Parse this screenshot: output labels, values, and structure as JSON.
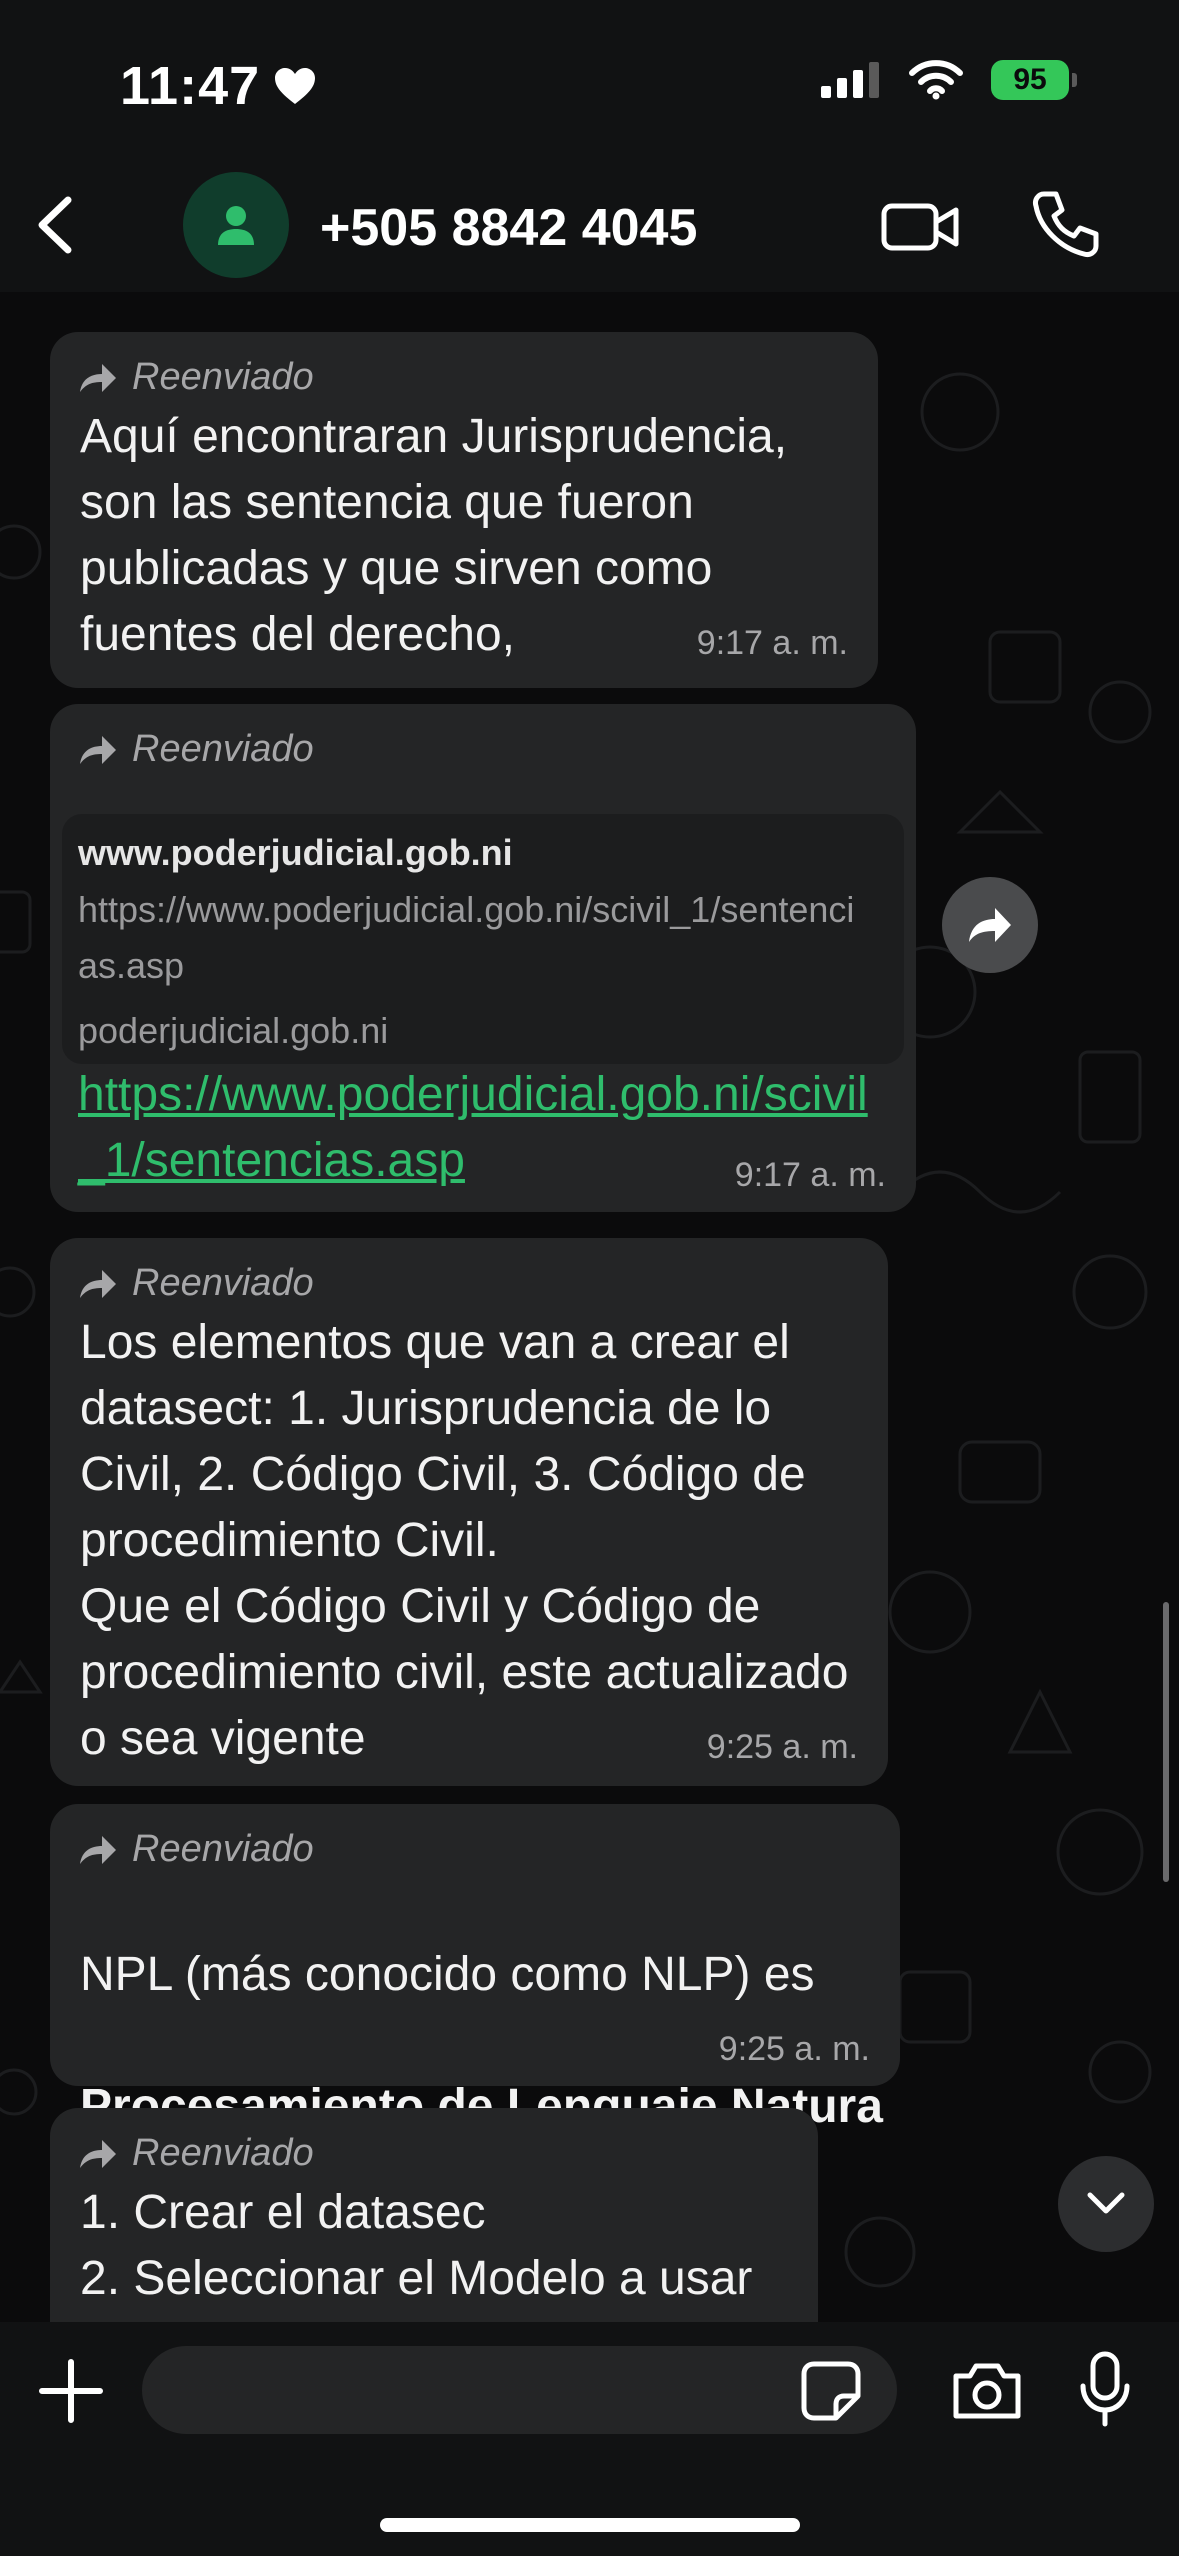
{
  "status": {
    "time": "11:47",
    "battery": "95"
  },
  "header": {
    "contact": "+505 8842 4045"
  },
  "messages": [
    {
      "forwarded": "Reenviado",
      "text": "Aquí encontraran Jurisprudencia, son las sentencia que fueron publicadas y que sirven como fuentes del derecho,",
      "time": "9:17 a. m."
    },
    {
      "forwarded": "Reenviado",
      "preview_title": "www.poderjudicial.gob.ni",
      "preview_url": "https://www.poderjudicial.gob.ni/scivil_1/sentencias.asp",
      "preview_domain": "poderjudicial.gob.ni",
      "link": "https://www.poderjudicial.gob.ni/scivil_1/sentencias.asp",
      "time": "9:17 a. m."
    },
    {
      "forwarded": "Reenviado",
      "text": "Los elementos que van a crear el datasect: 1. Jurisprudencia de lo Civil, 2. Código Civil, 3. Código de procedimiento Civil.\nQue el Código Civil y Código de procedimiento civil, este actualizado o sea vigente",
      "time": "9:25 a. m."
    },
    {
      "forwarded": "Reenviado",
      "text": "NPL (más conocido como NLP) es",
      "bold_text": "Procesamiento de Lenguaje Natura",
      "time": "9:25 a. m."
    },
    {
      "forwarded": "Reenviado",
      "text": "1. Crear el datasec\n2. Seleccionar el Modelo a usar"
    }
  ],
  "icons": {
    "accent": "#2fbd6c",
    "bubble": "#242526"
  }
}
